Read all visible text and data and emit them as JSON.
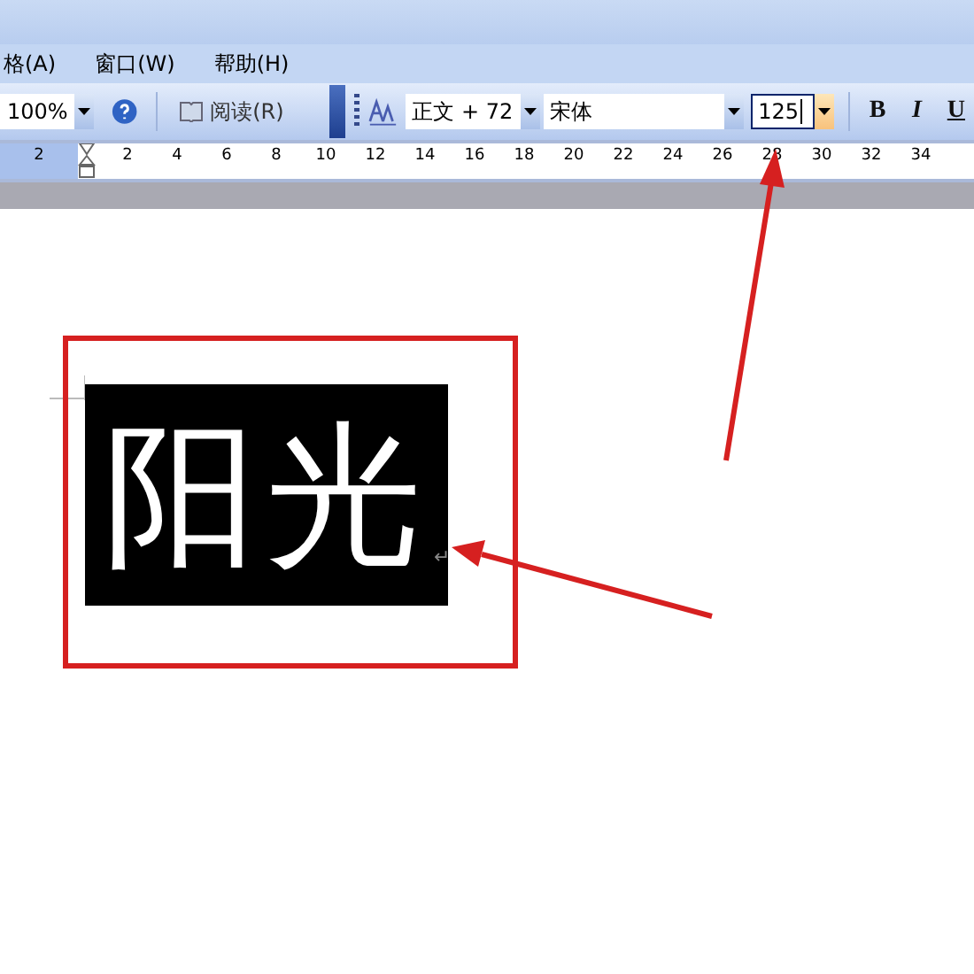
{
  "menu": [
    {
      "label": "格(A)"
    },
    {
      "label": "窗口(W)"
    },
    {
      "label": "帮助(H)"
    }
  ],
  "toolbar": {
    "zoom": "100%",
    "read_button": "阅读(R)",
    "style": "正文 + 72",
    "font": "宋体",
    "font_size": "125",
    "format_buttons": [
      {
        "label": "B",
        "kind": "bold"
      },
      {
        "label": "I",
        "kind": "italic"
      },
      {
        "label": "U",
        "kind": "underline"
      }
    ]
  },
  "ruler": {
    "left_label": "2",
    "ticks": [
      "2",
      "4",
      "6",
      "8",
      "10",
      "12",
      "14",
      "16",
      "18",
      "20",
      "22",
      "24",
      "26",
      "28",
      "30",
      "32",
      "34"
    ]
  },
  "document": {
    "text": "阳光",
    "selected": true,
    "paragraph_mark": "↵"
  }
}
